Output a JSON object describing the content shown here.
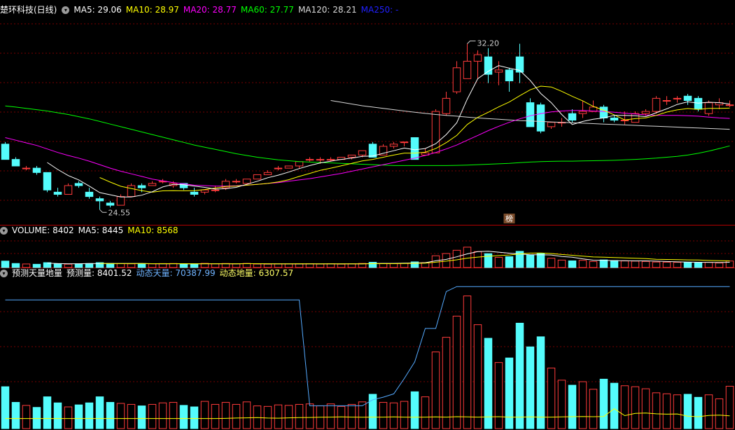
{
  "colors": {
    "up": "#ff3b3b",
    "down": "#54fcfc",
    "ma5": "#ffffff",
    "ma10": "#ffff00",
    "ma20": "#ff00ff",
    "ma60": "#00ff00",
    "ma120": "#d8d8d8",
    "ma250": "#0000ff",
    "grid": "#7a0000",
    "vline": "#55aaff"
  },
  "header_price": {
    "title": "楚环科技(日线)",
    "ma5": "MA5: 29.06",
    "ma10": "MA10: 28.97",
    "ma20": "MA20: 28.77",
    "ma60": "MA60: 27.77",
    "ma120": "MA120: 28.21",
    "ma250": "MA250: -"
  },
  "header_volume": {
    "title": "VOLUME: 8402",
    "ma5": "MA5: 8445",
    "ma10": "MA10: 8568"
  },
  "header_pred": {
    "title": "预测天量地量",
    "pred": "预测量: 8401.52",
    "dyn_high": "动态天量: 70387.99",
    "dyn_low": "动态地量: 6307.57"
  },
  "marker": "榜",
  "annotations": {
    "high": "32.20",
    "low": "24.55"
  },
  "chart_data": {
    "type": "candlestick",
    "candles": [
      [
        27.6,
        27.7,
        26.9,
        26.9
      ],
      [
        26.9,
        27.0,
        26.6,
        26.6
      ],
      [
        26.5,
        26.6,
        26.4,
        26.5
      ],
      [
        26.5,
        26.6,
        26.2,
        26.3
      ],
      [
        26.3,
        26.3,
        25.4,
        25.5
      ],
      [
        25.4,
        25.6,
        25.2,
        25.3
      ],
      [
        25.3,
        25.8,
        25.3,
        25.7
      ],
      [
        25.8,
        25.9,
        25.6,
        25.7
      ],
      [
        25.4,
        25.6,
        25.1,
        25.2
      ],
      [
        25.1,
        25.2,
        24.6,
        25.0
      ],
      [
        24.9,
        25.0,
        24.7,
        24.8
      ],
      [
        24.8,
        25.3,
        24.8,
        25.2
      ],
      [
        25.2,
        25.8,
        25.2,
        25.7
      ],
      [
        25.7,
        25.8,
        25.4,
        25.6
      ],
      [
        25.7,
        25.9,
        25.7,
        25.8
      ],
      [
        25.9,
        26.0,
        25.8,
        25.9
      ],
      [
        25.7,
        25.9,
        25.6,
        25.8
      ],
      [
        25.8,
        25.8,
        25.5,
        25.6
      ],
      [
        25.4,
        25.6,
        25.2,
        25.3
      ],
      [
        25.4,
        25.5,
        25.3,
        25.5
      ],
      [
        25.5,
        25.7,
        25.4,
        25.5
      ],
      [
        25.6,
        26.0,
        25.5,
        25.9
      ],
      [
        25.9,
        26.0,
        25.8,
        25.9
      ],
      [
        25.8,
        26.0,
        25.8,
        26.0
      ],
      [
        26.0,
        26.2,
        26.0,
        26.2
      ],
      [
        26.2,
        26.4,
        26.2,
        26.3
      ],
      [
        26.5,
        26.6,
        26.4,
        26.5
      ],
      [
        26.5,
        26.6,
        26.5,
        26.6
      ],
      [
        26.6,
        26.8,
        26.5,
        26.8
      ],
      [
        26.9,
        27.0,
        26.8,
        26.9
      ],
      [
        26.9,
        27.0,
        26.7,
        26.9
      ],
      [
        26.9,
        27.0,
        26.8,
        26.9
      ],
      [
        26.9,
        27.0,
        26.9,
        27.0
      ],
      [
        27.0,
        27.1,
        26.9,
        27.1
      ],
      [
        27.1,
        27.3,
        27.0,
        27.3
      ],
      [
        27.6,
        27.7,
        27.0,
        27.0
      ],
      [
        27.1,
        27.6,
        27.1,
        27.5
      ],
      [
        27.5,
        27.7,
        27.4,
        27.6
      ],
      [
        27.7,
        27.7,
        27.5,
        27.7
      ],
      [
        27.9,
        27.9,
        26.9,
        26.9
      ],
      [
        27.1,
        27.4,
        27.1,
        27.2
      ],
      [
        27.2,
        29.2,
        27.2,
        29.1
      ],
      [
        29.0,
        30.0,
        28.9,
        29.7
      ],
      [
        30.0,
        31.4,
        29.9,
        31.1
      ],
      [
        30.6,
        32.2,
        30.6,
        31.4
      ],
      [
        31.4,
        31.9,
        30.6,
        31.7
      ],
      [
        31.6,
        32.0,
        30.4,
        30.8
      ],
      [
        30.9,
        31.4,
        30.3,
        31.0
      ],
      [
        31.0,
        31.1,
        30.0,
        30.5
      ],
      [
        31.6,
        32.2,
        30.4,
        30.9
      ],
      [
        29.5,
        29.7,
        28.4,
        28.4
      ],
      [
        29.4,
        29.5,
        28.1,
        28.2
      ],
      [
        28.4,
        28.6,
        28.3,
        28.6
      ],
      [
        28.6,
        28.8,
        28.4,
        28.6
      ],
      [
        29.0,
        29.2,
        28.6,
        28.7
      ],
      [
        29.0,
        29.6,
        28.8,
        29.1
      ],
      [
        29.1,
        29.6,
        29.1,
        29.3
      ],
      [
        29.3,
        29.4,
        28.6,
        28.8
      ],
      [
        28.8,
        28.9,
        28.6,
        28.7
      ],
      [
        28.7,
        29.1,
        28.5,
        28.7
      ],
      [
        28.6,
        29.1,
        28.6,
        29.0
      ],
      [
        29.0,
        29.2,
        28.9,
        29.1
      ],
      [
        29.1,
        29.8,
        29.0,
        29.7
      ],
      [
        29.6,
        29.8,
        29.4,
        29.6
      ],
      [
        29.7,
        29.8,
        29.5,
        29.7
      ],
      [
        29.8,
        29.9,
        29.4,
        29.6
      ],
      [
        29.7,
        29.8,
        29.1,
        29.2
      ],
      [
        29.0,
        29.6,
        28.9,
        29.5
      ],
      [
        29.4,
        29.7,
        29.2,
        29.5
      ],
      [
        29.4,
        29.6,
        29.3,
        29.4
      ]
    ],
    "ma5": [
      null,
      null,
      null,
      null,
      26.76,
      26.44,
      26.16,
      25.96,
      25.68,
      25.38,
      25.28,
      25.18,
      25.18,
      25.26,
      25.42,
      25.64,
      25.76,
      25.74,
      25.68,
      25.62,
      25.54,
      25.56,
      25.62,
      25.76,
      25.9,
      26.06,
      26.18,
      26.32,
      26.48,
      26.62,
      26.74,
      26.82,
      26.9,
      26.96,
      27.04,
      27.06,
      27.18,
      27.3,
      27.42,
      27.34,
      27.4,
      27.62,
      28.04,
      28.58,
      29.66,
      30.6,
      30.94,
      31.2,
      31.08,
      30.98,
      30.52,
      29.92,
      29.5,
      28.96,
      28.5,
      28.64,
      28.74,
      28.8,
      28.92,
      28.92,
      28.9,
      28.86,
      29.04,
      29.22,
      29.42,
      29.54,
      29.48,
      29.52,
      29.5,
      29.44
    ],
    "ma10": [
      null,
      null,
      null,
      null,
      null,
      null,
      null,
      null,
      null,
      26.07,
      25.86,
      25.67,
      25.57,
      25.47,
      25.4,
      25.46,
      25.47,
      25.46,
      25.47,
      25.52,
      25.59,
      25.66,
      25.68,
      25.72,
      25.76,
      25.8,
      25.87,
      25.97,
      26.12,
      26.26,
      26.4,
      26.5,
      26.61,
      26.72,
      26.83,
      26.9,
      27.0,
      27.1,
      27.19,
      27.19,
      27.23,
      27.4,
      27.67,
      28.0,
      28.5,
      28.83,
      29.06,
      29.31,
      29.53,
      29.82,
      30.09,
      30.26,
      30.22,
      30.02,
      29.79,
      29.58,
      29.33,
      29.15,
      28.94,
      28.71,
      28.77,
      28.8,
      28.92,
      29.07,
      29.17,
      29.23,
      29.19,
      29.24,
      29.24,
      29.25
    ],
    "ma20": [
      27.9,
      27.78,
      27.66,
      27.54,
      27.38,
      27.22,
      27.08,
      26.96,
      26.82,
      26.66,
      26.5,
      26.36,
      26.24,
      26.12,
      26.0,
      25.92,
      25.84,
      25.78,
      25.72,
      25.7,
      25.68,
      25.68,
      25.69,
      25.72,
      25.76,
      25.8,
      25.84,
      25.9,
      25.96,
      26.02,
      26.1,
      26.18,
      26.26,
      26.36,
      26.46,
      26.56,
      26.66,
      26.76,
      26.86,
      26.96,
      27.08,
      27.22,
      27.38,
      27.56,
      27.78,
      28.0,
      28.22,
      28.42,
      28.6,
      28.76,
      28.9,
      29.0,
      29.08,
      29.12,
      29.14,
      29.14,
      29.12,
      29.1,
      29.06,
      29.02,
      28.98,
      28.94,
      28.92,
      28.92,
      28.92,
      28.9,
      28.88,
      28.84,
      28.8,
      28.78
    ],
    "ma60": [
      29.35,
      29.3,
      29.24,
      29.18,
      29.12,
      29.04,
      28.96,
      28.86,
      28.76,
      28.64,
      28.52,
      28.4,
      28.28,
      28.16,
      28.04,
      27.92,
      27.8,
      27.68,
      27.56,
      27.46,
      27.36,
      27.26,
      27.16,
      27.08,
      27.0,
      26.94,
      26.88,
      26.84,
      26.8,
      26.78,
      26.76,
      26.74,
      26.72,
      26.7,
      26.68,
      26.66,
      26.64,
      26.62,
      26.62,
      26.62,
      26.62,
      26.62,
      26.62,
      26.63,
      26.64,
      26.66,
      26.68,
      26.7,
      26.72,
      26.75,
      26.78,
      26.8,
      26.81,
      26.82,
      26.82,
      26.83,
      26.84,
      26.85,
      26.86,
      26.88,
      26.9,
      26.93,
      26.96,
      27.0,
      27.04,
      27.1,
      27.18,
      27.28,
      27.4,
      27.52
    ],
    "ma120": [
      null,
      null,
      null,
      null,
      null,
      null,
      null,
      null,
      null,
      null,
      null,
      null,
      null,
      null,
      null,
      null,
      null,
      null,
      null,
      null,
      null,
      null,
      null,
      null,
      null,
      null,
      null,
      null,
      null,
      null,
      null,
      29.6,
      29.52,
      29.44,
      29.36,
      29.3,
      29.24,
      29.18,
      29.12,
      29.06,
      29.01,
      28.96,
      28.92,
      28.88,
      28.84,
      28.8,
      28.77,
      28.74,
      28.71,
      28.68,
      28.66,
      28.64,
      28.62,
      28.6,
      28.58,
      28.56,
      28.54,
      28.52,
      28.5,
      28.48,
      28.46,
      28.44,
      28.42,
      28.4,
      28.38,
      28.36,
      28.34,
      28.32,
      28.3,
      28.28
    ],
    "volume": [
      8300,
      5200,
      4600,
      4200,
      6300,
      5100,
      4300,
      4700,
      5100,
      6300,
      5200,
      5000,
      4800,
      4500,
      4800,
      5100,
      5200,
      4600,
      4300,
      5400,
      4800,
      5200,
      4800,
      5300,
      4500,
      4400,
      4700,
      4600,
      4800,
      4900,
      4500,
      4900,
      4400,
      4800,
      5300,
      6800,
      5200,
      5100,
      5400,
      7300,
      6300,
      15200,
      18100,
      22300,
      26300,
      20600,
      17900,
      13100,
      14000,
      20900,
      16200,
      18200,
      12000,
      9600,
      8600,
      9300,
      7800,
      9800,
      9000,
      8500,
      8300,
      7900,
      7100,
      6900,
      6700,
      6800,
      6200,
      6700,
      5900,
      8400
    ],
    "vol_ma5": [
      null,
      null,
      null,
      null,
      5720,
      5080,
      4900,
      4920,
      5160,
      5100,
      5120,
      5140,
      5280,
      5160,
      4860,
      4840,
      4880,
      4840,
      4800,
      4920,
      4860,
      4860,
      4820,
      5100,
      4920,
      4840,
      4740,
      4660,
      4600,
      4660,
      4700,
      4720,
      4700,
      4720,
      4780,
      5240,
      5300,
      5320,
      5720,
      5840,
      6220,
      8660,
      10460,
      13840,
      17640,
      20500,
      21040,
      19840,
      18580,
      17560,
      16540,
      16580,
      16240,
      14180,
      13380,
      11180,
      9460,
      9200,
      8860,
      8800,
      8600,
      8640,
      8260,
      7740,
      7340,
      7080,
      6800,
      6660,
      6460,
      6800
    ],
    "vol_ma10": [
      null,
      null,
      null,
      null,
      null,
      null,
      null,
      null,
      null,
      5420,
      5110,
      5090,
      5110,
      5140,
      4990,
      4990,
      5020,
      4980,
      4920,
      4890,
      4850,
      4880,
      4880,
      4980,
      4950,
      4880,
      4830,
      4830,
      4880,
      4830,
      4800,
      4770,
      4730,
      4710,
      4740,
      4970,
      5020,
      5010,
      5170,
      5410,
      5620,
      6860,
      8230,
      9960,
      12080,
      13480,
      14570,
      15370,
      16180,
      17610,
      18620,
      18710,
      18100,
      16810,
      15800,
      14680,
      13670,
      13340,
      12890,
      12520,
      11900,
      11500,
      10690,
      10420,
      10110,
      9900,
      9690,
      9180,
      8860,
      8570
    ],
    "pred_line": [
      5500,
      5500,
      5500,
      5500,
      5500,
      5500,
      5500,
      5500,
      5500,
      5500,
      5500,
      5500,
      5500,
      5500,
      5500,
      5500,
      5500,
      5500,
      5500,
      5500,
      5500,
      5600,
      5800,
      5900,
      6000,
      5800,
      5700,
      5900,
      6000,
      6100,
      6200,
      6300,
      6400,
      6300,
      6200,
      6300,
      6300,
      6400,
      6300,
      6200,
      6300,
      6400,
      6300,
      6500,
      6400,
      6300,
      6400,
      6500,
      6300,
      6300,
      6400,
      6300,
      6300,
      6400,
      6500,
      6600,
      6500,
      6600,
      10900,
      7100,
      8300,
      8500,
      8100,
      7900,
      8000,
      6800,
      6500,
      7200,
      7400,
      7000
    ],
    "dyn_high": [
      70387.99,
      70387.99,
      70387.99,
      70387.99,
      70387.99,
      70387.99,
      70387.99,
      70387.99,
      70387.99,
      70387.99,
      70387.99,
      70387.99,
      70387.99,
      70387.99,
      70387.99,
      70387.99,
      70387.99,
      70387.99,
      70387.99,
      70387.99,
      70387.99,
      70387.99,
      70387.99,
      70387.99,
      70387.99,
      70387.99,
      70387.99,
      70387.99,
      70387.99,
      12500,
      12500,
      12500,
      12500,
      12500,
      12500,
      15800,
      17200,
      19000,
      27400,
      36500,
      54800,
      54800,
      75000,
      77700,
      77700,
      77700,
      77700,
      77700,
      77700,
      77700,
      77700,
      77700,
      77700,
      77700,
      77700,
      77700,
      77700,
      77700,
      77700,
      77700,
      77700,
      77700,
      77700,
      77700,
      77700,
      77700,
      77700,
      77700,
      77700,
      77700
    ],
    "y_range": [
      24.0,
      33.5
    ],
    "vol_range": [
      0,
      38000
    ],
    "pred_range": [
      0,
      82000
    ]
  }
}
